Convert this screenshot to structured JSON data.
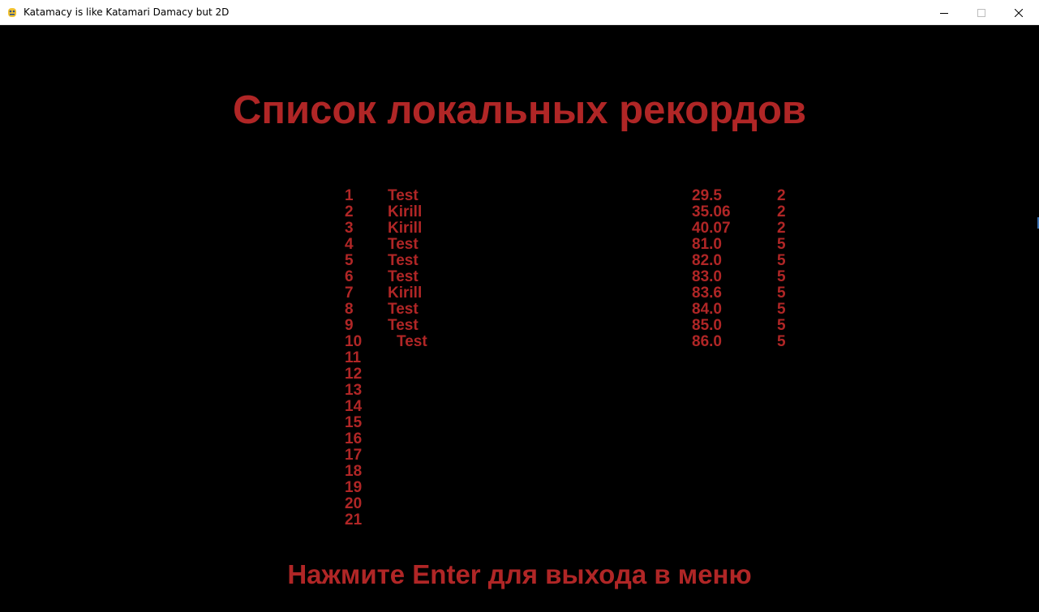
{
  "window": {
    "title": "Katamacy is like Katamari Damacy but 2D",
    "icon": "pygame-snake-icon",
    "minimize_icon": "minimize-icon",
    "maximize_icon": "maximize-icon",
    "close_icon": "close-icon"
  },
  "colors": {
    "text": "#b02626",
    "background": "#000000"
  },
  "screen": {
    "heading": "Список локальных рекордов",
    "footer": "Нажмите Enter для выхода в меню"
  },
  "records": [
    {
      "rank": "1",
      "name": "Test",
      "time": "29.5",
      "level": "2"
    },
    {
      "rank": "2",
      "name": "Kirill",
      "time": "35.06",
      "level": "2"
    },
    {
      "rank": "3",
      "name": "Kirill",
      "time": "40.07",
      "level": "2"
    },
    {
      "rank": "4",
      "name": "Test",
      "time": "81.0",
      "level": "5"
    },
    {
      "rank": "5",
      "name": "Test",
      "time": "82.0",
      "level": "5"
    },
    {
      "rank": "6",
      "name": "Test",
      "time": "83.0",
      "level": "5"
    },
    {
      "rank": "7",
      "name": "Kirill",
      "time": "83.6",
      "level": "5"
    },
    {
      "rank": "8",
      "name": "Test",
      "time": "84.0",
      "level": "5"
    },
    {
      "rank": "9",
      "name": "Test",
      "time": "85.0",
      "level": "5"
    },
    {
      "rank": "10",
      "name": "Test",
      "time": "86.0",
      "level": "5"
    },
    {
      "rank": "11"
    },
    {
      "rank": "12"
    },
    {
      "rank": "13"
    },
    {
      "rank": "14"
    },
    {
      "rank": "15"
    },
    {
      "rank": "16"
    },
    {
      "rank": "17"
    },
    {
      "rank": "18"
    },
    {
      "rank": "19"
    },
    {
      "rank": "20"
    },
    {
      "rank": "21"
    }
  ]
}
